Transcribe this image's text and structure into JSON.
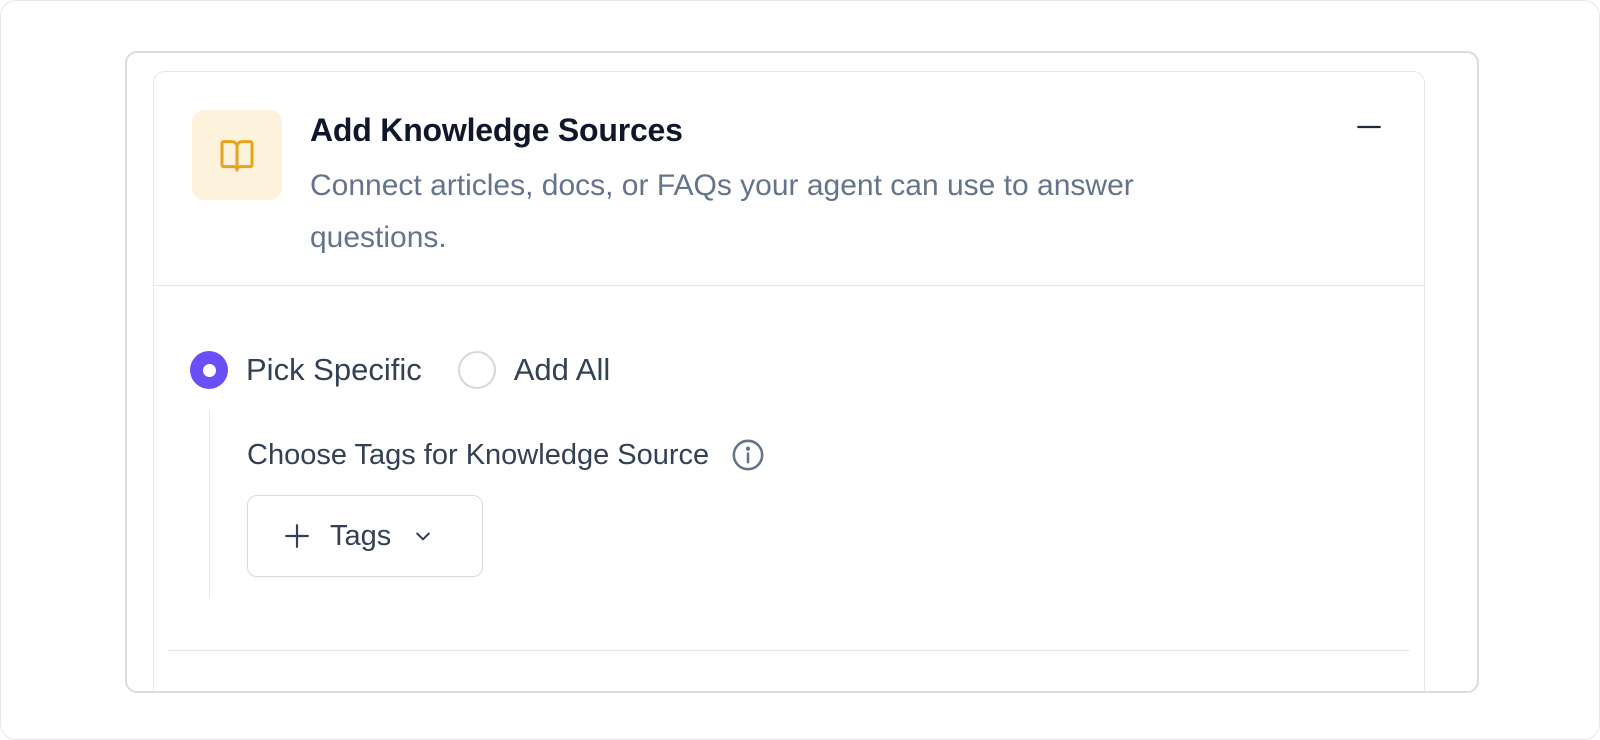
{
  "colors": {
    "accent": "#6b4ef6",
    "icon_tile_bg": "#fdf3dd",
    "icon_color": "#e8a21c",
    "title": "#0f172a",
    "muted_text": "#64748b"
  },
  "knowledge_panel": {
    "icon": "book-open-icon",
    "title": "Add Knowledge Sources",
    "description": "Connect articles, docs, or FAQs your agent can use to answer questions.",
    "collapse_icon": "minus-icon"
  },
  "selection_mode": {
    "selected": "Pick Specific",
    "options": [
      {
        "label": "Pick Specific",
        "checked": true
      },
      {
        "label": "Add All",
        "checked": false
      }
    ]
  },
  "tags": {
    "label": "Choose Tags for Knowledge Source",
    "info_icon": "info-icon",
    "button_label": "Tags",
    "button_icons": [
      "plus-icon",
      "chevron-down-icon"
    ]
  }
}
